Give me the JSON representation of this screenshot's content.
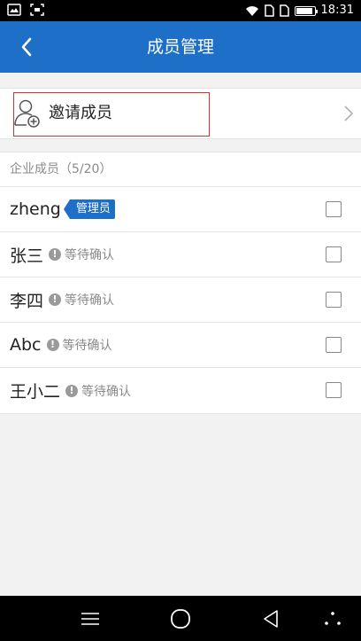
{
  "status_bar": {
    "time": "18:31"
  },
  "header": {
    "title": "成员管理",
    "back_icon": "chevron-left-icon"
  },
  "invite": {
    "label": "邀请成员",
    "icon": "add-user-icon",
    "chevron_icon": "chevron-right-icon"
  },
  "members": {
    "section_title": "企业成员（5/20）",
    "admin_badge": "管理员",
    "items": [
      {
        "name": "zheng",
        "role": "admin",
        "status": ""
      },
      {
        "name": "张三",
        "role": "member",
        "status": "等待确认"
      },
      {
        "name": "李四",
        "role": "member",
        "status": "等待确认"
      },
      {
        "name": "Abc",
        "role": "member",
        "status": "等待确认"
      },
      {
        "name": "王小二",
        "role": "member",
        "status": "等待确认"
      }
    ],
    "pending_icon_glyph": "!"
  },
  "colors": {
    "accent": "#1e6fc7",
    "highlight_border": "#d9302f",
    "background": "#f2f2f2"
  }
}
